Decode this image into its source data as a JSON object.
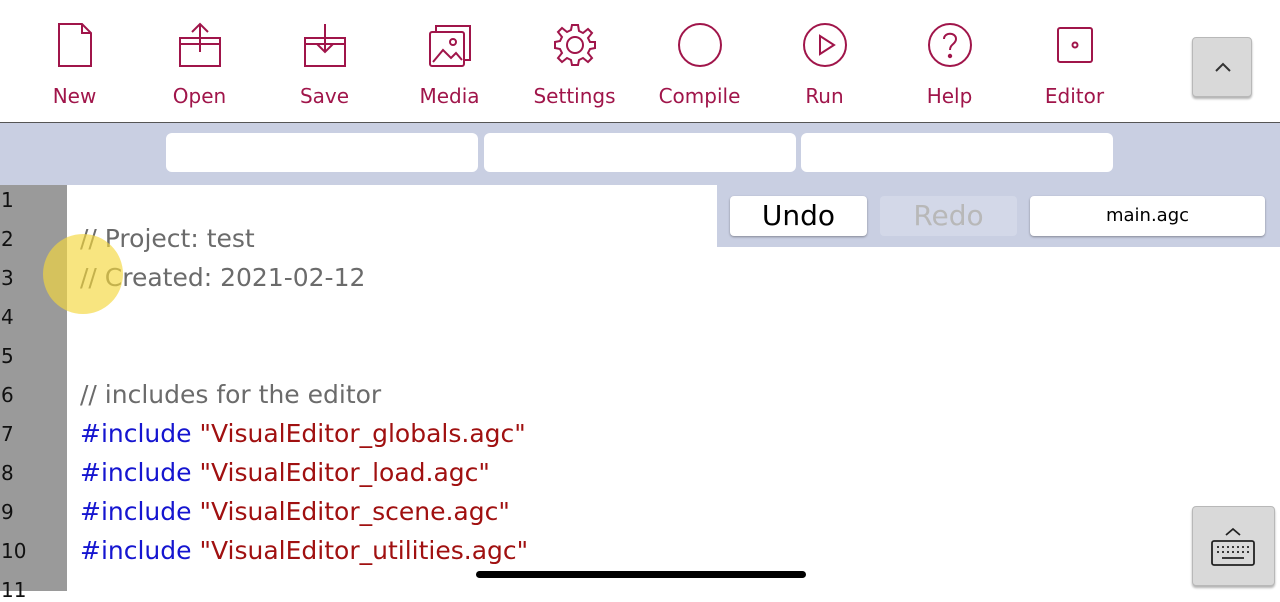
{
  "toolbar": {
    "items": [
      {
        "label": "New",
        "icon": "new-file-icon"
      },
      {
        "label": "Open",
        "icon": "open-icon"
      },
      {
        "label": "Save",
        "icon": "save-icon"
      },
      {
        "label": "Media",
        "icon": "media-icon"
      },
      {
        "label": "Settings",
        "icon": "gear-icon"
      },
      {
        "label": "Compile",
        "icon": "compile-circle-icon"
      },
      {
        "label": "Run",
        "icon": "play-icon"
      },
      {
        "label": "Help",
        "icon": "help-icon"
      },
      {
        "label": "Editor",
        "icon": "editor-icon"
      }
    ],
    "accent_color": "#a0154a"
  },
  "tabs": [
    "",
    "",
    ""
  ],
  "editor": {
    "line_numbers": [
      "1",
      "2",
      "3",
      "4",
      "5",
      "6",
      "7",
      "8",
      "9",
      "10",
      "11"
    ],
    "lines": {
      "l2": "// Project: test",
      "l3": "// Created: 2021-02-12",
      "l6": "// includes for the editor",
      "l7": {
        "kw": "#include",
        "str": "\"VisualEditor_globals.agc\""
      },
      "l8": {
        "kw": "#include",
        "str": "\"VisualEditor_load.agc\""
      },
      "l9": {
        "kw": "#include",
        "str": "\"VisualEditor_scene.agc\""
      },
      "l10": {
        "kw": "#include",
        "str": "\"VisualEditor_utilities.agc\""
      }
    }
  },
  "panel": {
    "undo": "Undo",
    "redo": "Redo",
    "file": "main.agc"
  }
}
